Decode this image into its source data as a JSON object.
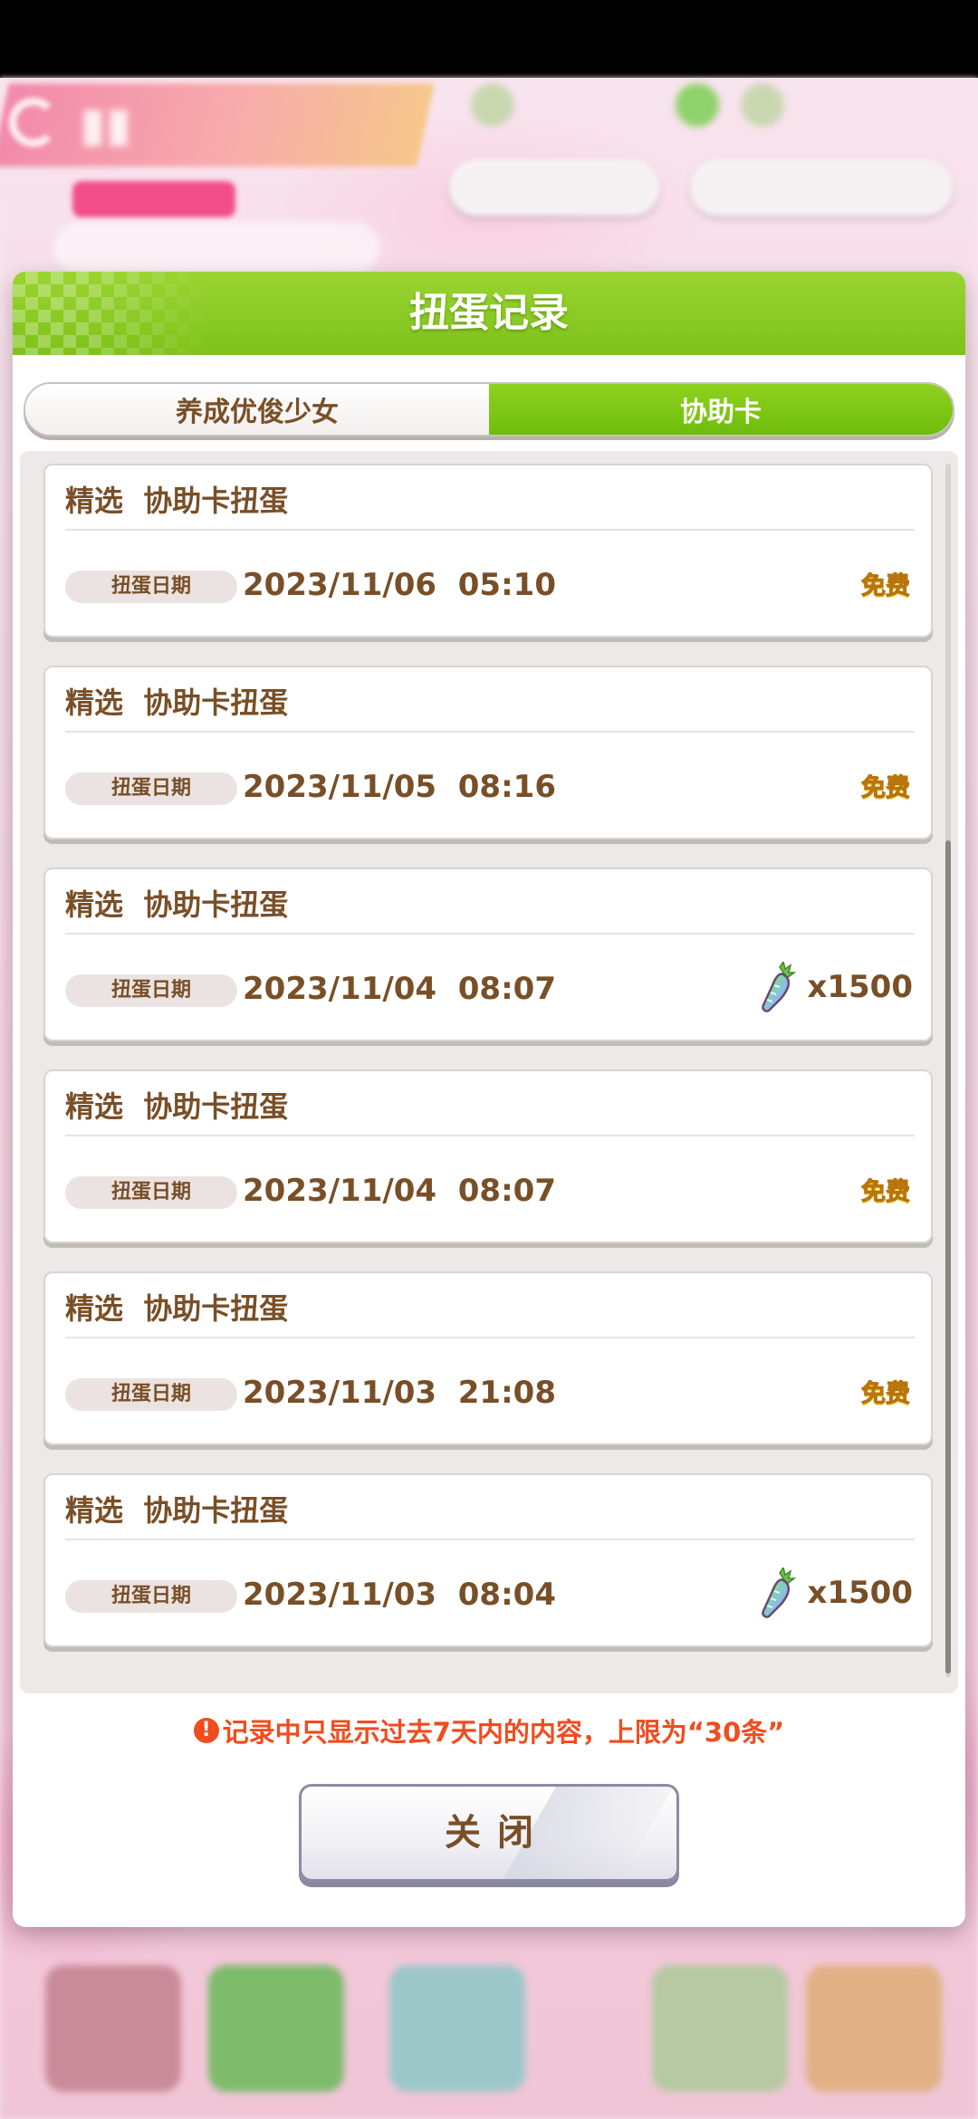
{
  "dialog": {
    "title": "扭蛋记录",
    "tabs": [
      {
        "label": "养成优俊少女",
        "active": false
      },
      {
        "label": "协助卡",
        "active": true
      }
    ],
    "date_badge_label": "扭蛋日期",
    "records": [
      {
        "title": "精选  协助卡扭蛋",
        "date": "2023/11/06  05:10",
        "cost_type": "free",
        "cost_label": "免费"
      },
      {
        "title": "精选  协助卡扭蛋",
        "date": "2023/11/05  08:16",
        "cost_type": "free",
        "cost_label": "免费"
      },
      {
        "title": "精选  协助卡扭蛋",
        "date": "2023/11/04  08:07",
        "cost_type": "carrot",
        "cost_label": "x1500"
      },
      {
        "title": "精选  协助卡扭蛋",
        "date": "2023/11/04  08:07",
        "cost_type": "free",
        "cost_label": "免费"
      },
      {
        "title": "精选  协助卡扭蛋",
        "date": "2023/11/03  21:08",
        "cost_type": "free",
        "cost_label": "免费"
      },
      {
        "title": "精选  协助卡扭蛋",
        "date": "2023/11/03  08:04",
        "cost_type": "carrot",
        "cost_label": "x1500"
      }
    ],
    "notice": "记录中只显示过去7天内的内容，上限为“30条”",
    "close_label": "关闭"
  },
  "icons": {
    "warning": "warning-icon",
    "currency": "carrot-icon"
  },
  "colors": {
    "header_green": "#7ec21a",
    "active_tab_green": "#6fbc0c",
    "text_brown": "#794f27",
    "free_gold": "#e8a80c",
    "notice_red": "#f04c1e"
  }
}
